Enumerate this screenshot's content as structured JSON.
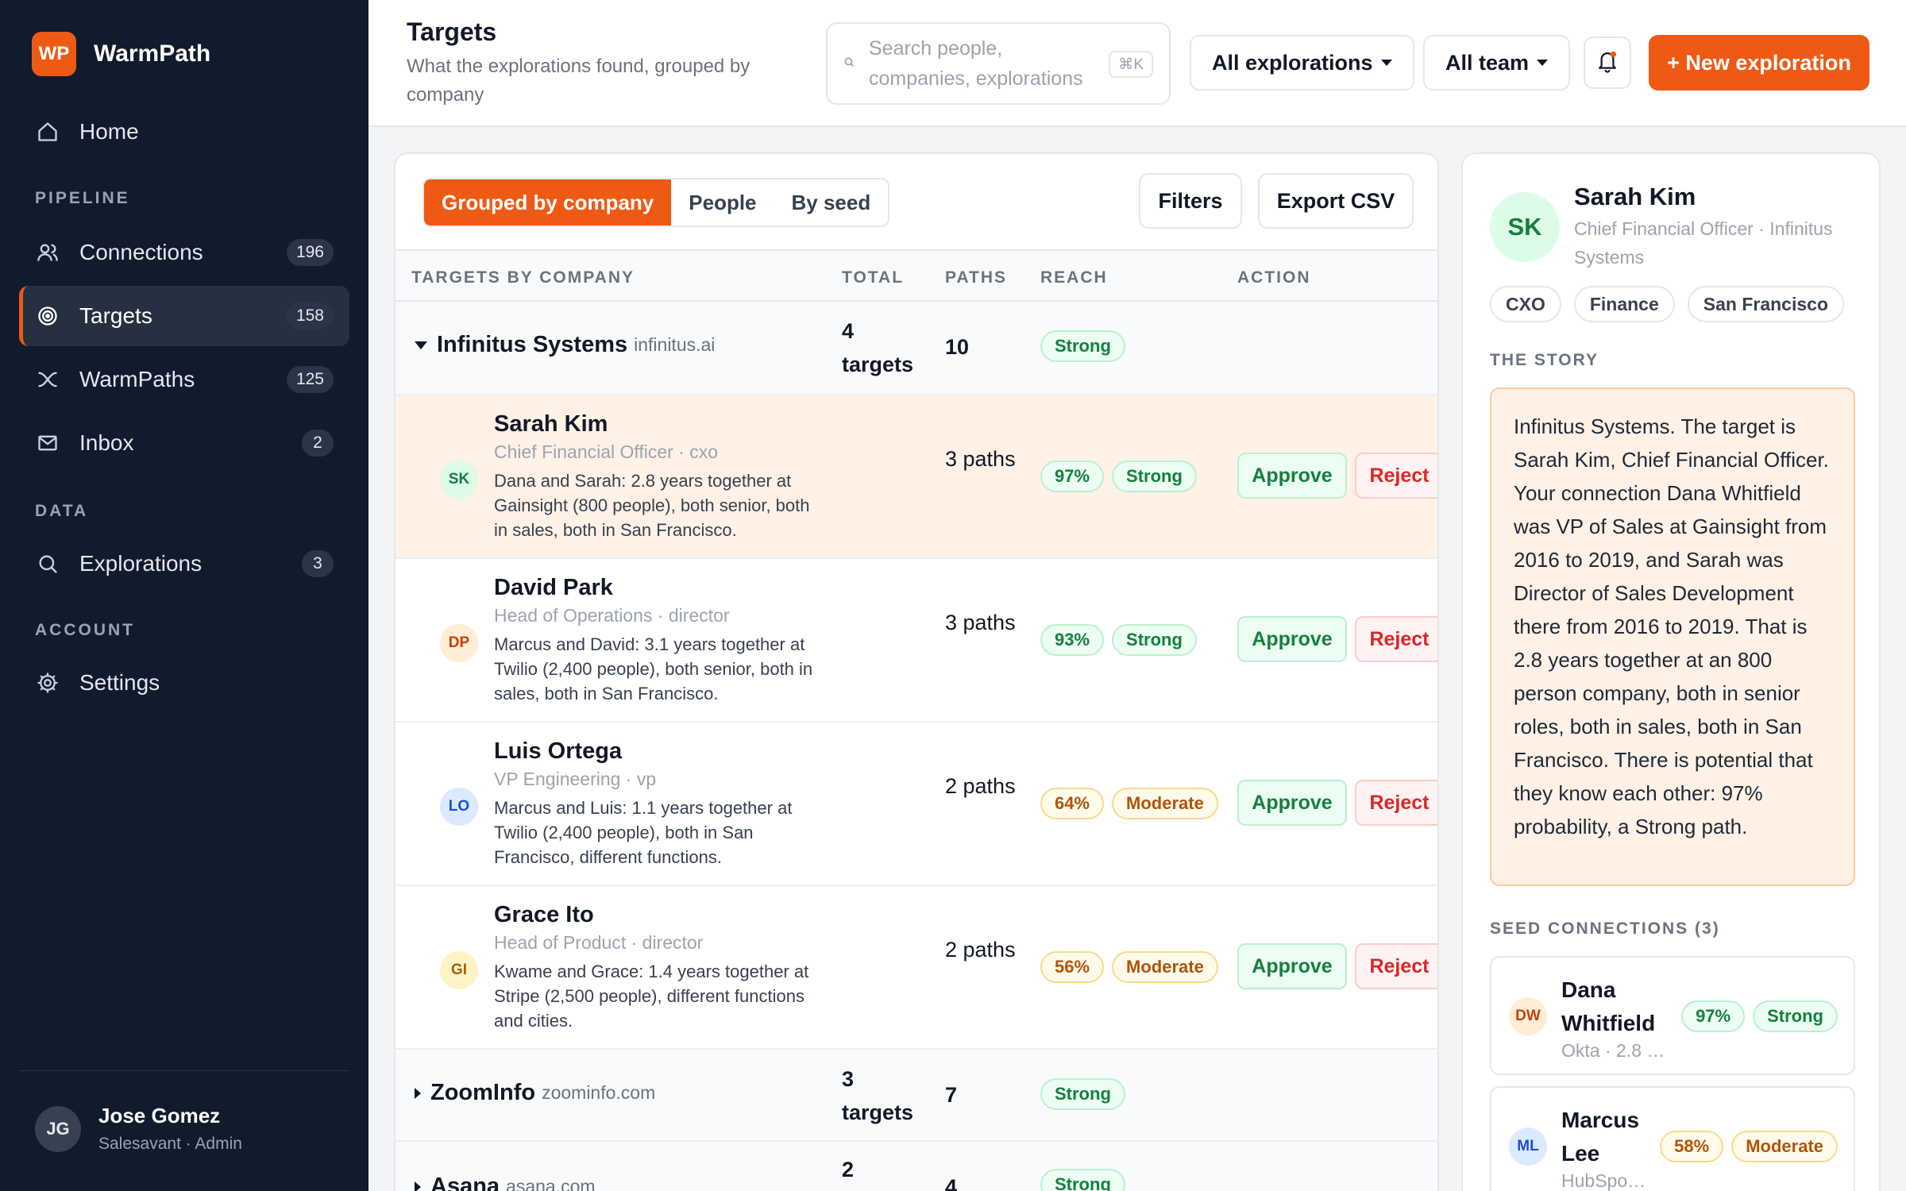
{
  "app": {
    "logo": "WP",
    "name": "WarmPath"
  },
  "sidebar": {
    "home": "Home",
    "pipeline_label": "PIPELINE",
    "data_label": "DATA",
    "account_label": "ACCOUNT",
    "connections": {
      "label": "Connections",
      "count": "196"
    },
    "targets": {
      "label": "Targets",
      "count": "158"
    },
    "warmpaths": {
      "label": "WarmPaths",
      "count": "125"
    },
    "inbox": {
      "label": "Inbox",
      "count": "2"
    },
    "explorations": {
      "label": "Explorations",
      "count": "3"
    },
    "settings": "Settings",
    "user": {
      "initials": "JG",
      "name": "Jose Gomez",
      "role": "Salesavant · Admin"
    }
  },
  "header": {
    "title": "Targets",
    "subtitle": "What the explorations found, grouped by company",
    "search_placeholder": "Search people, companies, explorations",
    "shortcut": "⌘K",
    "explorations_filter": "All explorations",
    "team_filter": "All team",
    "new_button": "+ New exploration"
  },
  "toolbar": {
    "views": [
      "Grouped by company",
      "People",
      "By seed"
    ],
    "filters": "Filters",
    "export": "Export CSV"
  },
  "table": {
    "columns": [
      "TARGETS BY COMPANY",
      "TOTAL",
      "PATHS",
      "REACH",
      "ACTION"
    ],
    "approve": "Approve",
    "reject": "Reject",
    "groups": [
      {
        "name": "Infinitus Systems",
        "domain": "infinitus.ai",
        "total": "4 targets",
        "paths": "10",
        "reach": "Strong"
      },
      {
        "name": "ZoomInfo",
        "domain": "zoominfo.com",
        "total": "3 targets",
        "paths": "7",
        "reach": "Strong"
      },
      {
        "name": "Asana",
        "domain": "asana.com",
        "total": "2",
        "paths": "4",
        "reach": "Strong"
      }
    ],
    "targets": [
      {
        "initials": "SK",
        "name": "Sarah Kim",
        "role": "Chief Financial Officer · cxo",
        "reason": "Dana and Sarah: 2.8 years together at Gainsight (800 people), both senior, both in sales, both in San Francisco.",
        "paths": "3 paths",
        "pct": "97%",
        "reach": "Strong"
      },
      {
        "initials": "DP",
        "name": "David Park",
        "role": "Head of Operations · director",
        "reason": "Marcus and David: 3.1 years together at Twilio (2,400 people), both senior, both in sales, both in San Francisco.",
        "paths": "3 paths",
        "pct": "93%",
        "reach": "Strong"
      },
      {
        "initials": "LO",
        "name": "Luis Ortega",
        "role": "VP Engineering · vp",
        "reason": "Marcus and Luis: 1.1 years together at Twilio (2,400 people), both in San Francisco, different functions.",
        "paths": "2 paths",
        "pct": "64%",
        "reach": "Moderate"
      },
      {
        "initials": "GI",
        "name": "Grace Ito",
        "role": "Head of Product · director",
        "reason": "Kwame and Grace: 1.4 years together at Stripe (2,500 people), different functions and cities.",
        "paths": "2 paths",
        "pct": "56%",
        "reach": "Moderate"
      }
    ]
  },
  "detail": {
    "initials": "SK",
    "name": "Sarah Kim",
    "role": "Chief Financial Officer · Infinitus Systems",
    "tags": [
      "CXO",
      "Finance",
      "San Francisco"
    ],
    "story_label": "THE STORY",
    "story": "Infinitus Systems. The target is Sarah Kim, Chief Financial Officer. Your connection Dana Whitfield was VP of Sales at Gainsight from 2016 to 2019, and Sarah was Director of Sales Development there from 2016 to 2019. That is 2.8 years together at an 800 person company, both in senior roles, both in sales, both in San Francisco. There is potential that they know each other: 97% probability, a Strong path.",
    "seeds_label": "SEED CONNECTIONS (3)",
    "seeds": [
      {
        "initials": "DW",
        "name": "Dana Whitfield",
        "company": "Okta · 2.8 …",
        "pct": "97%",
        "reach": "Strong"
      },
      {
        "initials": "ML",
        "name": "Marcus Lee",
        "company": "HubSpo…",
        "pct": "58%",
        "reach": "Moderate"
      }
    ]
  },
  "colors": {
    "accent": "#ee5a14",
    "sidebar": "#111b2e",
    "strong": "#15803d",
    "moderate": "#b45309",
    "reject": "#dc2626"
  }
}
